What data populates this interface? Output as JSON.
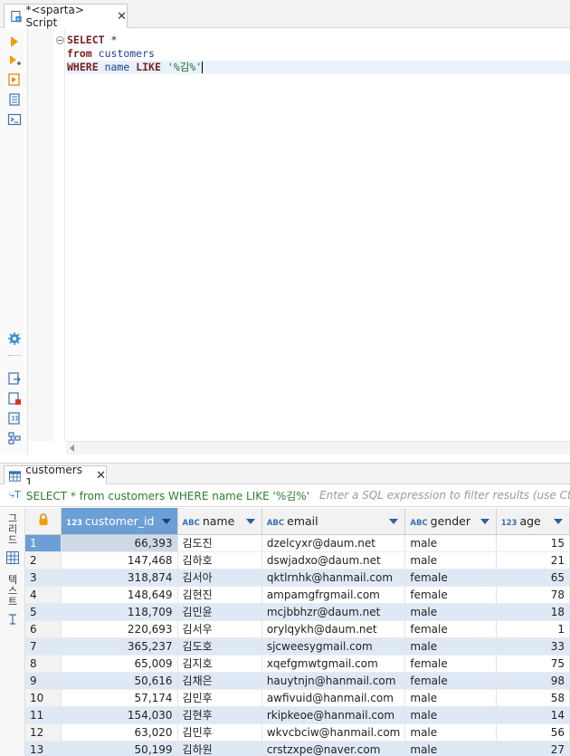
{
  "editor_tab": {
    "label": "*<sparta> Script",
    "close": "✕"
  },
  "toolbar_icons": [
    "execute-statement-icon",
    "execute-script-icon",
    "execute-in-new-tab-icon",
    "explain-plan-icon",
    "open-console-icon",
    "settings-icon",
    "export-icon",
    "import-icon",
    "load-script-icon",
    "outline-icon"
  ],
  "sql": {
    "line1": {
      "kw1": "SELECT",
      "rest": " *"
    },
    "line2": {
      "kw1": "from",
      "space": " ",
      "table": "customers"
    },
    "line3": {
      "kw1": "WHERE",
      "col": "name",
      "kw2": "LIKE",
      "str": "'%김%'"
    }
  },
  "results_tab": {
    "label": "customers 1",
    "close": "✕"
  },
  "filter": {
    "query": "SELECT * from customers WHERE name LIKE '%김%'",
    "placeholder": "Enter a SQL expression to filter results (use Ctrl+Spac"
  },
  "side_tabs": {
    "grid": "그리드",
    "text": "텍스트"
  },
  "columns": [
    {
      "type": "123",
      "label": "customer_id"
    },
    {
      "type": "ABC",
      "label": "name"
    },
    {
      "type": "ABC",
      "label": "email"
    },
    {
      "type": "ABC",
      "label": "gender"
    },
    {
      "type": "123",
      "label": "age"
    }
  ],
  "rows": [
    {
      "n": "1",
      "id": "66,393",
      "name": "김도진",
      "email": "dzelcyxr@daum.net",
      "gender": "male",
      "age": "15"
    },
    {
      "n": "2",
      "id": "147,468",
      "name": "김하호",
      "email": "dswjadxo@daum.net",
      "gender": "male",
      "age": "21"
    },
    {
      "n": "3",
      "id": "318,874",
      "name": "김서아",
      "email": "qktlrnhk@hanmail.com",
      "gender": "female",
      "age": "65"
    },
    {
      "n": "4",
      "id": "148,649",
      "name": "김현진",
      "email": "ampamgfrgmail.com",
      "gender": "female",
      "age": "78"
    },
    {
      "n": "5",
      "id": "118,709",
      "name": "김민윤",
      "email": "mcjbbhzr@daum.net",
      "gender": "male",
      "age": "18"
    },
    {
      "n": "6",
      "id": "220,693",
      "name": "김서우",
      "email": "orylqykh@daum.net",
      "gender": "female",
      "age": "1"
    },
    {
      "n": "7",
      "id": "365,237",
      "name": "김도호",
      "email": "sjcweesygmail.com",
      "gender": "male",
      "age": "33"
    },
    {
      "n": "8",
      "id": "65,009",
      "name": "김지호",
      "email": "xqefgmwtgmail.com",
      "gender": "female",
      "age": "75"
    },
    {
      "n": "9",
      "id": "50,616",
      "name": "김채은",
      "email": "hauytnjn@hanmail.com",
      "gender": "female",
      "age": "98"
    },
    {
      "n": "10",
      "id": "57,174",
      "name": "김민후",
      "email": "awfivuid@hanmail.com",
      "gender": "male",
      "age": "58"
    },
    {
      "n": "11",
      "id": "154,030",
      "name": "김현후",
      "email": "rkipkeoe@hanmail.com",
      "gender": "male",
      "age": "14"
    },
    {
      "n": "12",
      "id": "63,020",
      "name": "김민후",
      "email": "wkvcbciw@hanmail.com",
      "gender": "male",
      "age": "56"
    },
    {
      "n": "13",
      "id": "50,199",
      "name": "김하원",
      "email": "crstzxpe@naver.com",
      "gender": "male",
      "age": "27"
    }
  ],
  "colors": {
    "accent": "#6b9fd6",
    "alt_row": "#dfe9f5",
    "keyword": "#7a1f1f",
    "string": "#1c6f2a"
  }
}
